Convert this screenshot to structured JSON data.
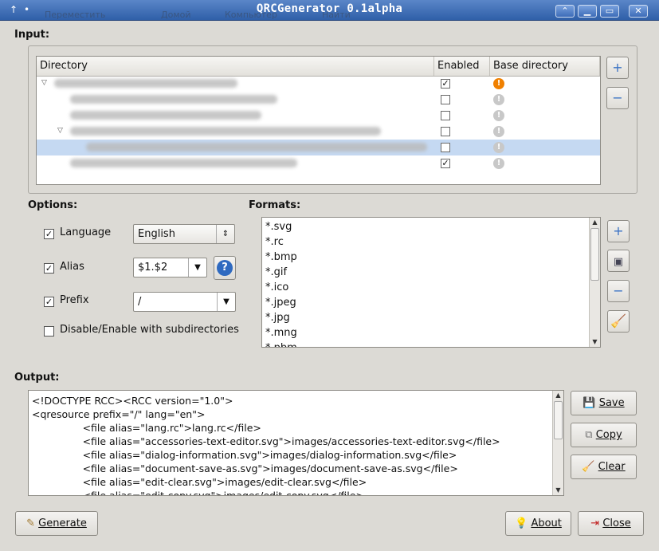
{
  "window": {
    "title": "QRCGenerator 0.1alpha",
    "ghost_menu": [
      "Переместить",
      "Домой",
      "Компьютер",
      "Найти"
    ]
  },
  "input": {
    "heading": "Input:",
    "columns": [
      "Directory",
      "Enabled",
      "Base directory"
    ],
    "rows": [
      {
        "enabled": true,
        "base": true,
        "depth": 0,
        "expanded": true
      },
      {
        "enabled": false,
        "base": false,
        "depth": 1
      },
      {
        "enabled": false,
        "base": false,
        "depth": 1
      },
      {
        "enabled": false,
        "base": false,
        "depth": 1,
        "expanded": true
      },
      {
        "enabled": false,
        "base": false,
        "depth": 2,
        "selected": true
      },
      {
        "enabled": true,
        "base": false,
        "depth": 1
      }
    ],
    "add_icon": "+",
    "remove_icon": "−"
  },
  "options": {
    "heading": "Options:",
    "language_label": "Language",
    "language_value": "English",
    "alias_label": "Alias",
    "alias_value": "$1.$2",
    "prefix_label": "Prefix",
    "prefix_value": "/",
    "subdirs_label": "Disable/Enable with subdirectories",
    "help_icon": "?"
  },
  "formats": {
    "heading": "Formats:",
    "items": [
      "*.svg",
      "*.rc",
      "*.bmp",
      "*.gif",
      "*.ico",
      "*.jpeg",
      "*.jpg",
      "*.mng",
      "*.pbm"
    ]
  },
  "output": {
    "heading": "Output:",
    "lines": [
      "<!DOCTYPE RCC><RCC version=\"1.0\">",
      "<qresource prefix=\"/\" lang=\"en\">",
      "                <file alias=\"lang.rc\">lang.rc</file>",
      "                <file alias=\"accessories-text-editor.svg\">images/accessories-text-editor.svg</file>",
      "                <file alias=\"dialog-information.svg\">images/dialog-information.svg</file>",
      "                <file alias=\"document-save-as.svg\">images/document-save-as.svg</file>",
      "                <file alias=\"edit-clear.svg\">images/edit-clear.svg</file>",
      "                <file alias=\"edit-copy.svg\">images/edit-copy.svg</file>"
    ],
    "save_label": "Save",
    "copy_label": "Copy",
    "clear_label": "Clear"
  },
  "footer": {
    "generate_label": "Generate",
    "about_label": "About",
    "close_label": "Close"
  },
  "colors": {
    "titlebar": "#2f5fa8",
    "selection": "#c5d9f2",
    "warning": "#f08000"
  }
}
